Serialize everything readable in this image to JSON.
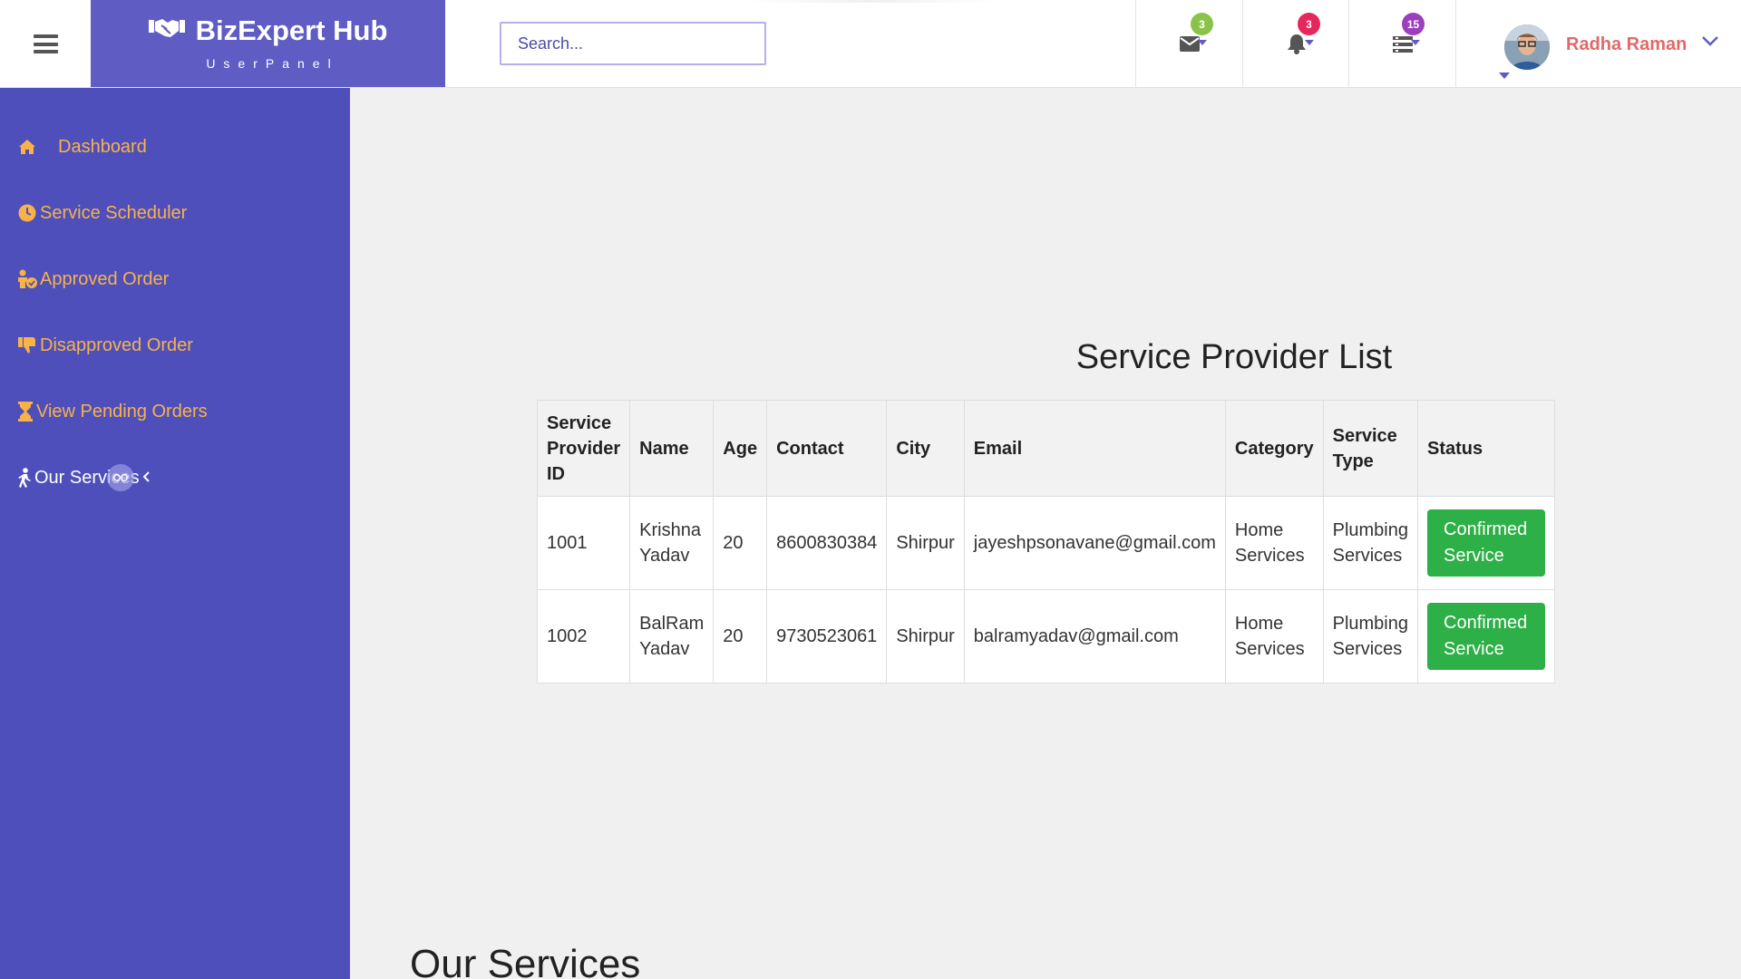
{
  "header": {
    "brand_title": "BizExpert Hub",
    "brand_subtitle": "UserPanel",
    "search_placeholder": "Search...",
    "messages_count": "3",
    "notifications_count": "3",
    "tasks_count": "15",
    "user_name": "Radha Raman"
  },
  "sidebar": {
    "items": [
      {
        "label": "Dashboard",
        "icon": "home-icon"
      },
      {
        "label": "Service Scheduler",
        "icon": "clock-icon"
      },
      {
        "label": "Approved Order",
        "icon": "person-check-icon"
      },
      {
        "label": "Disapproved Order",
        "icon": "thumbs-down-icon"
      },
      {
        "label": "View Pending Orders",
        "icon": "hourglass-icon"
      },
      {
        "label": "Our Services",
        "icon": "walking-person-icon"
      }
    ],
    "active_index": 5
  },
  "main": {
    "list_title": "Service Provider List",
    "columns": [
      "Service Provider ID",
      "Name",
      "Age",
      "Contact",
      "City",
      "Email",
      "Category",
      "Service Type",
      "Status"
    ],
    "rows": [
      {
        "id": "1001",
        "name": "Krishna Yadav",
        "age": "20",
        "contact": "8600830384",
        "city": "Shirpur",
        "email": "jayeshpsonavane@gmail.com",
        "category": "Home Services",
        "service_type": "Plumbing Services",
        "status": "Confirmed Service"
      },
      {
        "id": "1002",
        "name": "BalRam Yadav",
        "age": "20",
        "contact": "9730523061",
        "city": "Shirpur",
        "email": "balramyadav@gmail.com",
        "category": "Home Services",
        "service_type": "Plumbing Services",
        "status": "Confirmed Service"
      }
    ],
    "services_heading": "Our Services"
  },
  "colors": {
    "brand": "#5f5cc4",
    "sidebar": "#4e4fbb",
    "sidebar_text": "#f7b24a",
    "confirm": "#2eb048",
    "badge_messages": "#8bc34a",
    "badge_notifications": "#e8265e",
    "badge_tasks": "#9c3fbf",
    "user_name": "#e06a6a"
  }
}
